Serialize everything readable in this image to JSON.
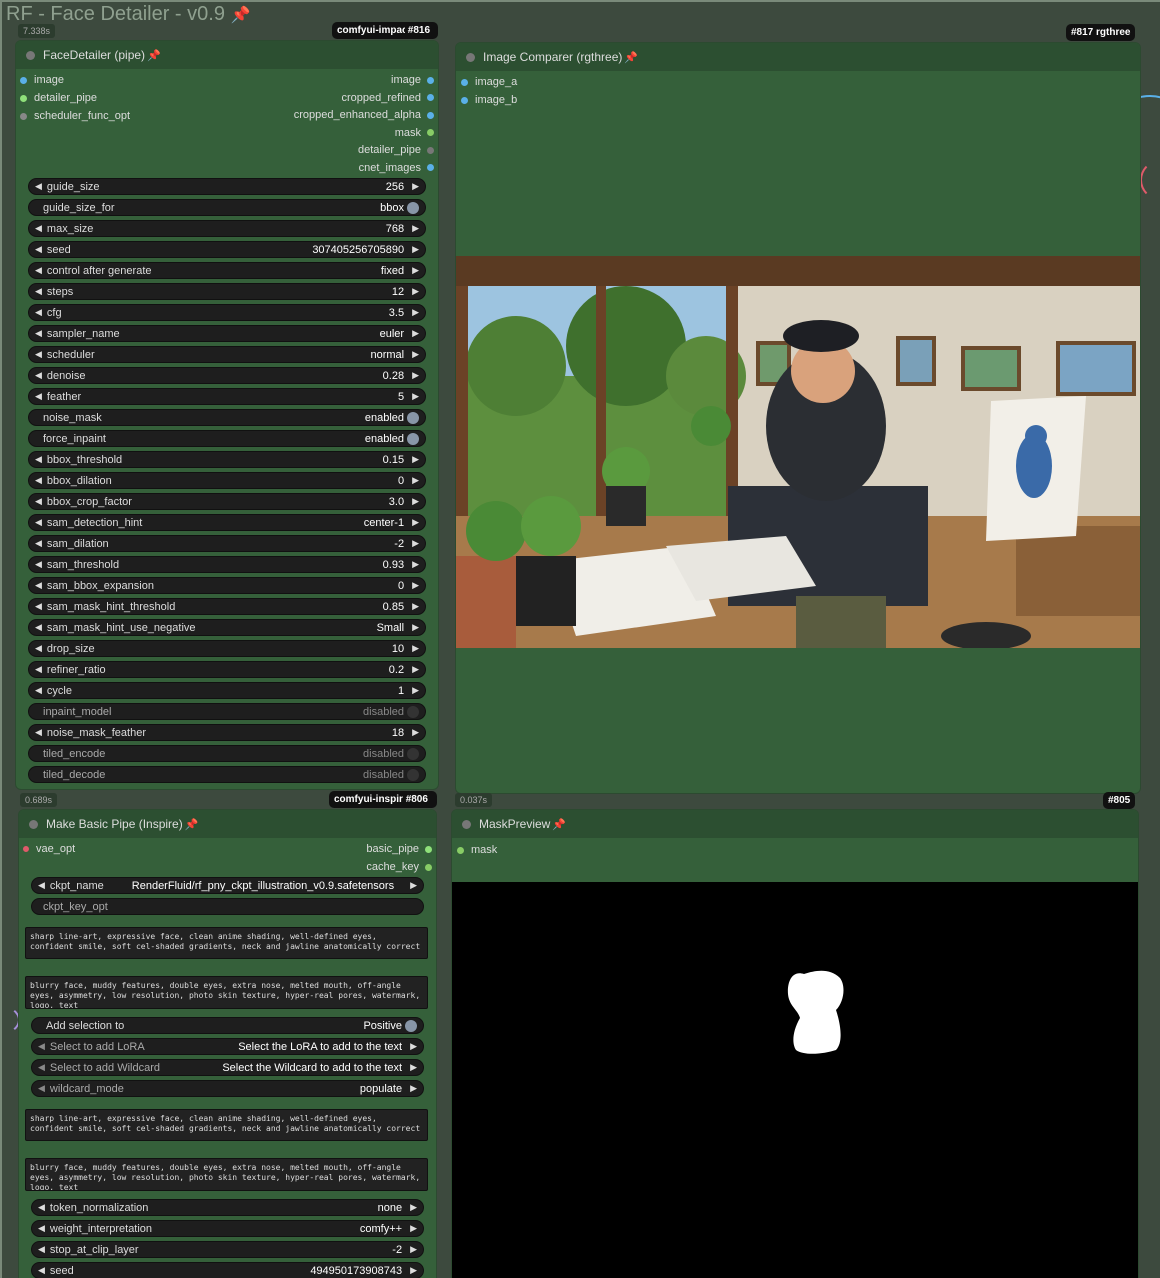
{
  "group": {
    "title": "RF - Face Detailer - v0.9"
  },
  "colors": {
    "node_bg": "#35603a",
    "node_header": "#2c4f31",
    "widget_bg": "#1e1e1e",
    "canvas": "#3d4a3e",
    "pin": "#e0332b",
    "slot_image": "#5ab0e8",
    "slot_pipe": "#8fe07a",
    "slot_mask": "#88cc66"
  },
  "face_detailer": {
    "title": "FaceDetailer (pipe)",
    "badge": "comfyui-impac",
    "node_id": "#816",
    "timer": "7.338s",
    "inputs": [
      "image",
      "detailer_pipe",
      "scheduler_func_opt"
    ],
    "outputs": [
      "image",
      "cropped_refined",
      "cropped_enhanced_alpha",
      "mask",
      "detailer_pipe",
      "cnet_images"
    ],
    "widgets": [
      {
        "label": "guide_size",
        "value": "256",
        "kind": "num"
      },
      {
        "label": "guide_size_for",
        "value": "bbox",
        "kind": "toggle"
      },
      {
        "label": "max_size",
        "value": "768",
        "kind": "num"
      },
      {
        "label": "seed",
        "value": "307405256705890",
        "kind": "num"
      },
      {
        "label": "control after generate",
        "value": "fixed",
        "kind": "num"
      },
      {
        "label": "steps",
        "value": "12",
        "kind": "num"
      },
      {
        "label": "cfg",
        "value": "3.5",
        "kind": "num"
      },
      {
        "label": "sampler_name",
        "value": "euler",
        "kind": "num"
      },
      {
        "label": "scheduler",
        "value": "normal",
        "kind": "num"
      },
      {
        "label": "denoise",
        "value": "0.28",
        "kind": "num"
      },
      {
        "label": "feather",
        "value": "5",
        "kind": "num"
      },
      {
        "label": "noise_mask",
        "value": "enabled",
        "kind": "toggle"
      },
      {
        "label": "force_inpaint",
        "value": "enabled",
        "kind": "toggle"
      },
      {
        "label": "bbox_threshold",
        "value": "0.15",
        "kind": "num"
      },
      {
        "label": "bbox_dilation",
        "value": "0",
        "kind": "num"
      },
      {
        "label": "bbox_crop_factor",
        "value": "3.0",
        "kind": "num"
      },
      {
        "label": "sam_detection_hint",
        "value": "center-1",
        "kind": "num"
      },
      {
        "label": "sam_dilation",
        "value": "-2",
        "kind": "num"
      },
      {
        "label": "sam_threshold",
        "value": "0.93",
        "kind": "num"
      },
      {
        "label": "sam_bbox_expansion",
        "value": "0",
        "kind": "num"
      },
      {
        "label": "sam_mask_hint_threshold",
        "value": "0.85",
        "kind": "num"
      },
      {
        "label": "sam_mask_hint_use_negative",
        "value": "Small",
        "kind": "num"
      },
      {
        "label": "drop_size",
        "value": "10",
        "kind": "num"
      },
      {
        "label": "refiner_ratio",
        "value": "0.2",
        "kind": "num"
      },
      {
        "label": "cycle",
        "value": "1",
        "kind": "num"
      },
      {
        "label": "inpaint_model",
        "value": "disabled",
        "kind": "toggle-off"
      },
      {
        "label": "noise_mask_feather",
        "value": "18",
        "kind": "num"
      },
      {
        "label": "tiled_encode",
        "value": "disabled",
        "kind": "toggle-off"
      },
      {
        "label": "tiled_decode",
        "value": "disabled",
        "kind": "toggle-off"
      }
    ]
  },
  "image_comparer": {
    "title": "Image Comparer (rgthree)",
    "badge": "rgthree",
    "node_id": "#817",
    "inputs": [
      "image_a",
      "image_b"
    ],
    "timer": "0.037s"
  },
  "make_basic_pipe": {
    "title": "Make Basic Pipe (Inspire)",
    "badge": "comfyui-inspir",
    "node_id": "#806",
    "timer": "0.689s",
    "inputs": [
      "vae_opt"
    ],
    "outputs": [
      "basic_pipe",
      "cache_key"
    ],
    "ckpt_name_label": "ckpt_name",
    "ckpt_name": "RenderFluid/rf_pny_ckpt_illustration_v0.9.safetensors",
    "ckpt_key_opt": "ckpt_key_opt",
    "positive_prompt": "sharp line-art, expressive face, clean anime shading, well-defined eyes, confident smile, soft cel-shaded gradients, neck and jawline anatomically correct",
    "negative_prompt": "blurry face, muddy features, double eyes, extra nose, melted mouth, off-angle eyes, asymmetry, low resolution, photo skin texture, hyper-real pores, watermark, logo, text",
    "add_selection_label": "Add selection to",
    "add_selection_value": "Positive",
    "lora_label": "Select to add LoRA",
    "lora_value": "Select the LoRA to add to the text",
    "wildcard_label": "Select to add Wildcard",
    "wildcard_value": "Select the Wildcard to add to the text",
    "wildcard_mode_label": "wildcard_mode",
    "wildcard_mode_value": "populate",
    "positive_prompt_2": "sharp line-art, expressive face, clean anime shading, well-defined eyes, confident smile, soft cel-shaded gradients, neck and jawline anatomically correct",
    "negative_prompt_2": "blurry face, muddy features, double eyes, extra nose, melted mouth, off-angle eyes, asymmetry, low resolution, photo skin texture, hyper-real pores, watermark, logo, text",
    "widgets2": [
      {
        "label": "token_normalization",
        "value": "none"
      },
      {
        "label": "weight_interpretation",
        "value": "comfy++"
      },
      {
        "label": "stop_at_clip_layer",
        "value": "-2"
      },
      {
        "label": "seed",
        "value": "494950173908743"
      }
    ]
  },
  "mask_preview": {
    "title": "MaskPreview",
    "node_id": "#805",
    "inputs": [
      "mask"
    ]
  }
}
